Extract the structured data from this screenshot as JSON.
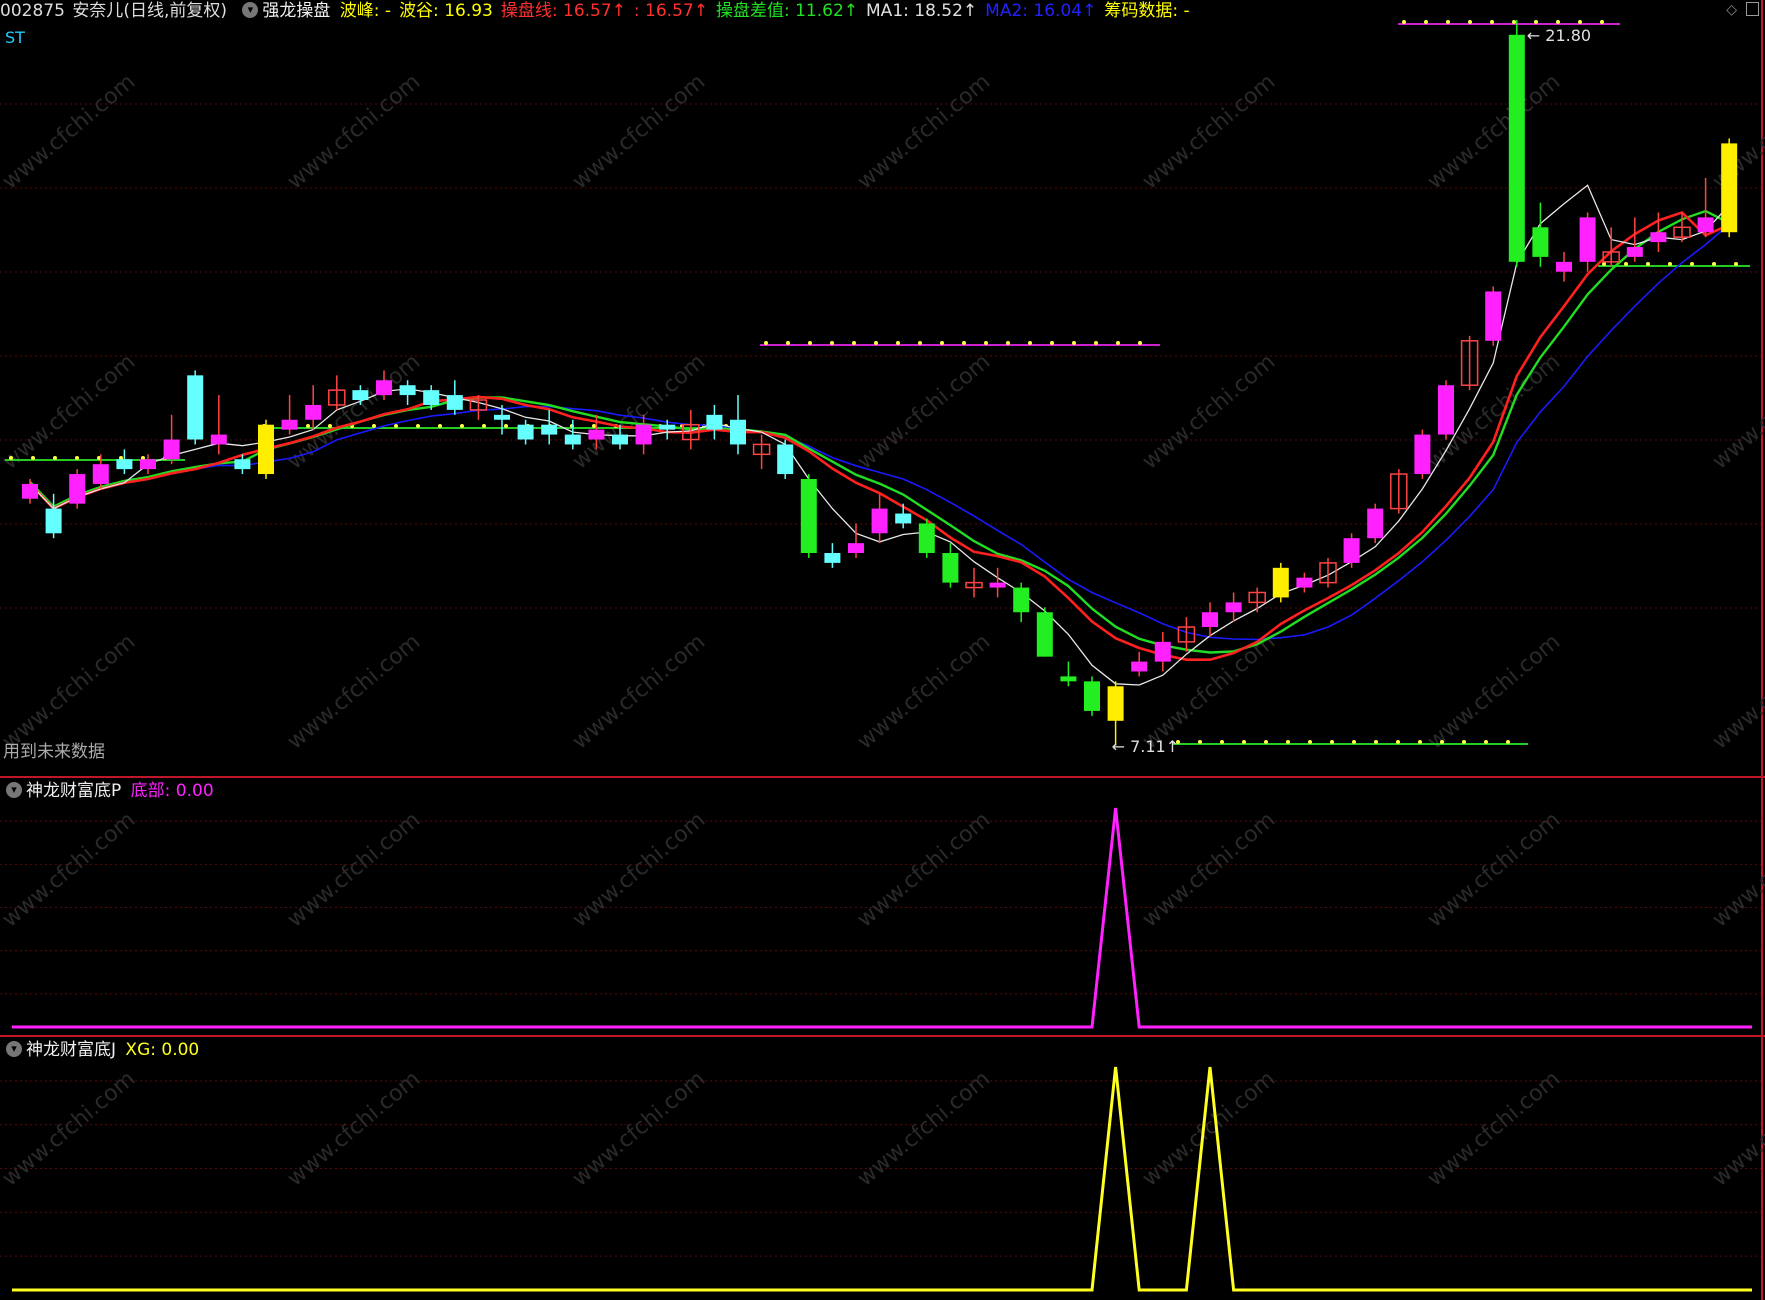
{
  "main_panel": {
    "header": {
      "code": "002875",
      "name": "安奈儿",
      "period": "(日线,前复权)",
      "indicator": "强龙操盘",
      "items": [
        {
          "label": "波峰:",
          "value": " -",
          "color": "#ffff00"
        },
        {
          "label": "波谷:",
          "value": " 16.93",
          "color": "#ffff00"
        },
        {
          "label": "操盘线:",
          "value": " 16.57",
          "color": "#ff3030",
          "arrow": "↑"
        },
        {
          "label": "",
          "value": ": 16.57",
          "color": "#ff3030",
          "arrow": "↑"
        },
        {
          "label": "操盘差值:",
          "value": " 11.62",
          "color": "#22e022",
          "arrow": "↑"
        },
        {
          "label": "MA1:",
          "value": " 18.52",
          "color": "#e0e0e0",
          "arrow": "↑"
        },
        {
          "label": "MA2:",
          "value": " 16.04",
          "color": "#2222ff",
          "arrow": "↑"
        },
        {
          "label": "筹码数据:",
          "value": " -",
          "color": "#ffff00"
        }
      ]
    },
    "st_label": "ST",
    "future_data_label": "用到未来数据",
    "high_label": "21.80",
    "low_label": "7.11"
  },
  "sub_panel_1": {
    "name": "神龙财富底P",
    "series_label": "底部:",
    "series_value": " 0.00",
    "color": "#ff22ff"
  },
  "sub_panel_2": {
    "name": "神龙财富底J",
    "series_label": "XG:",
    "series_value": " 0.00",
    "color": "#ffff22"
  },
  "watermark": "www.cfchi.com",
  "colors": {
    "up_candle": "#ff22ff",
    "down_candle": "#66ffff",
    "strong_down": "#22ee22",
    "signal": "#ffee00",
    "ma_white": "#e8e8e8",
    "ma_red": "#ff2020",
    "ma_blue": "#1a1aff",
    "ma_green": "#22dd22",
    "grid": "#5a0a0a"
  },
  "chart_data": [
    {
      "type": "candlestick",
      "title": "强龙操盘",
      "high": 21.8,
      "low": 7.11,
      "candles": [
        {
          "o": 12.1,
          "c": 12.4,
          "h": 12.5,
          "l": 12.0,
          "k": "up"
        },
        {
          "o": 11.9,
          "c": 11.4,
          "h": 12.2,
          "l": 11.3,
          "k": "dn"
        },
        {
          "o": 12.0,
          "c": 12.6,
          "h": 12.7,
          "l": 11.9,
          "k": "up"
        },
        {
          "o": 12.4,
          "c": 12.8,
          "h": 13.0,
          "l": 12.3,
          "k": "up"
        },
        {
          "o": 12.7,
          "c": 12.9,
          "h": 13.1,
          "l": 12.6,
          "k": "dn"
        },
        {
          "o": 12.7,
          "c": 12.9,
          "h": 13.0,
          "l": 12.6,
          "k": "up"
        },
        {
          "o": 12.9,
          "c": 13.3,
          "h": 13.8,
          "l": 12.8,
          "k": "up"
        },
        {
          "o": 14.6,
          "c": 13.3,
          "h": 14.7,
          "l": 13.2,
          "k": "dn"
        },
        {
          "o": 13.2,
          "c": 13.4,
          "h": 14.2,
          "l": 13.0,
          "k": "up"
        },
        {
          "o": 12.9,
          "c": 12.7,
          "h": 13.0,
          "l": 12.6,
          "k": "dn"
        },
        {
          "o": 12.6,
          "c": 13.6,
          "h": 13.7,
          "l": 12.5,
          "k": "sig"
        },
        {
          "o": 13.5,
          "c": 13.7,
          "h": 14.2,
          "l": 13.4,
          "k": "up"
        },
        {
          "o": 13.7,
          "c": 14.0,
          "h": 14.4,
          "l": 13.5,
          "k": "up"
        },
        {
          "o": 14.0,
          "c": 14.3,
          "h": 14.6,
          "l": 13.9,
          "k": "up"
        },
        {
          "o": 14.1,
          "c": 14.3,
          "h": 14.4,
          "l": 14.0,
          "k": "dn"
        },
        {
          "o": 14.2,
          "c": 14.5,
          "h": 14.7,
          "l": 14.1,
          "k": "up"
        },
        {
          "o": 14.4,
          "c": 14.2,
          "h": 14.5,
          "l": 14.0,
          "k": "dn"
        },
        {
          "o": 14.3,
          "c": 14.0,
          "h": 14.4,
          "l": 13.9,
          "k": "dn"
        },
        {
          "o": 14.2,
          "c": 13.9,
          "h": 14.5,
          "l": 13.8,
          "k": "dn"
        },
        {
          "o": 13.9,
          "c": 14.1,
          "h": 14.2,
          "l": 13.7,
          "k": "up"
        },
        {
          "o": 13.8,
          "c": 13.7,
          "h": 14.0,
          "l": 13.4,
          "k": "dn"
        },
        {
          "o": 13.6,
          "c": 13.3,
          "h": 13.7,
          "l": 13.2,
          "k": "dn"
        },
        {
          "o": 13.4,
          "c": 13.6,
          "h": 13.9,
          "l": 13.2,
          "k": "dn"
        },
        {
          "o": 13.4,
          "c": 13.2,
          "h": 13.7,
          "l": 13.1,
          "k": "dn"
        },
        {
          "o": 13.3,
          "c": 13.5,
          "h": 13.8,
          "l": 13.1,
          "k": "up"
        },
        {
          "o": 13.4,
          "c": 13.2,
          "h": 13.6,
          "l": 13.1,
          "k": "dn"
        },
        {
          "o": 13.2,
          "c": 13.6,
          "h": 13.8,
          "l": 13.0,
          "k": "up"
        },
        {
          "o": 13.6,
          "c": 13.5,
          "h": 13.7,
          "l": 13.3,
          "k": "dn"
        },
        {
          "o": 13.3,
          "c": 13.6,
          "h": 13.9,
          "l": 13.1,
          "k": "up"
        },
        {
          "o": 13.5,
          "c": 13.8,
          "h": 14.0,
          "l": 13.3,
          "k": "dn"
        },
        {
          "o": 13.7,
          "c": 13.2,
          "h": 14.2,
          "l": 13.0,
          "k": "dn"
        },
        {
          "o": 13.0,
          "c": 13.2,
          "h": 13.4,
          "l": 12.7,
          "k": "up"
        },
        {
          "o": 13.2,
          "c": 12.6,
          "h": 13.3,
          "l": 12.5,
          "k": "dn"
        },
        {
          "o": 12.5,
          "c": 11.0,
          "h": 12.6,
          "l": 10.9,
          "k": "grn"
        },
        {
          "o": 11.0,
          "c": 10.8,
          "h": 11.2,
          "l": 10.7,
          "k": "dn"
        },
        {
          "o": 11.0,
          "c": 11.2,
          "h": 11.6,
          "l": 10.9,
          "k": "up"
        },
        {
          "o": 11.4,
          "c": 11.9,
          "h": 12.2,
          "l": 11.2,
          "k": "up"
        },
        {
          "o": 11.8,
          "c": 11.6,
          "h": 12.0,
          "l": 11.5,
          "k": "dn"
        },
        {
          "o": 11.6,
          "c": 11.0,
          "h": 11.7,
          "l": 10.9,
          "k": "grn"
        },
        {
          "o": 11.0,
          "c": 10.4,
          "h": 11.2,
          "l": 10.3,
          "k": "grn"
        },
        {
          "o": 10.4,
          "c": 10.3,
          "h": 10.7,
          "l": 10.1,
          "k": "up"
        },
        {
          "o": 10.4,
          "c": 10.3,
          "h": 10.7,
          "l": 10.1,
          "k": "up"
        },
        {
          "o": 10.3,
          "c": 9.8,
          "h": 10.4,
          "l": 9.6,
          "k": "grn"
        },
        {
          "o": 9.8,
          "c": 8.9,
          "h": 9.9,
          "l": 8.9,
          "k": "grn"
        },
        {
          "o": 8.5,
          "c": 8.4,
          "h": 8.8,
          "l": 8.3,
          "k": "grn"
        },
        {
          "o": 8.4,
          "c": 7.8,
          "h": 8.5,
          "l": 7.7,
          "k": "grn"
        },
        {
          "o": 7.6,
          "c": 8.3,
          "h": 8.4,
          "l": 7.1,
          "k": "sig"
        },
        {
          "o": 8.6,
          "c": 8.8,
          "h": 9.0,
          "l": 8.5,
          "k": "up"
        },
        {
          "o": 8.8,
          "c": 9.2,
          "h": 9.4,
          "l": 8.6,
          "k": "up"
        },
        {
          "o": 9.2,
          "c": 9.5,
          "h": 9.7,
          "l": 9.0,
          "k": "up"
        },
        {
          "o": 9.5,
          "c": 9.8,
          "h": 10.0,
          "l": 9.3,
          "k": "up"
        },
        {
          "o": 9.8,
          "c": 10.0,
          "h": 10.2,
          "l": 9.6,
          "k": "up"
        },
        {
          "o": 10.0,
          "c": 10.2,
          "h": 10.3,
          "l": 9.8,
          "k": "up"
        },
        {
          "o": 10.1,
          "c": 10.7,
          "h": 10.8,
          "l": 10.0,
          "k": "sig"
        },
        {
          "o": 10.3,
          "c": 10.5,
          "h": 10.6,
          "l": 10.2,
          "k": "up"
        },
        {
          "o": 10.4,
          "c": 10.8,
          "h": 10.9,
          "l": 10.3,
          "k": "up"
        },
        {
          "o": 10.8,
          "c": 11.3,
          "h": 11.4,
          "l": 10.7,
          "k": "up"
        },
        {
          "o": 11.3,
          "c": 11.9,
          "h": 12.0,
          "l": 11.2,
          "k": "up"
        },
        {
          "o": 11.9,
          "c": 12.6,
          "h": 12.7,
          "l": 11.8,
          "k": "up"
        },
        {
          "o": 12.6,
          "c": 13.4,
          "h": 13.5,
          "l": 12.5,
          "k": "up"
        },
        {
          "o": 13.4,
          "c": 14.4,
          "h": 14.5,
          "l": 13.3,
          "k": "up"
        },
        {
          "o": 14.4,
          "c": 15.3,
          "h": 15.4,
          "l": 14.3,
          "k": "up"
        },
        {
          "o": 15.3,
          "c": 16.3,
          "h": 16.4,
          "l": 15.2,
          "k": "up"
        },
        {
          "o": 16.9,
          "c": 21.5,
          "h": 21.8,
          "l": 16.8,
          "k": "grn"
        },
        {
          "o": 17.0,
          "c": 17.6,
          "h": 18.1,
          "l": 16.8,
          "k": "grn"
        },
        {
          "o": 16.7,
          "c": 16.9,
          "h": 17.1,
          "l": 16.5,
          "k": "up"
        },
        {
          "o": 16.9,
          "c": 17.8,
          "h": 17.9,
          "l": 16.7,
          "k": "up"
        },
        {
          "o": 16.9,
          "c": 17.1,
          "h": 17.6,
          "l": 16.8,
          "k": "up"
        },
        {
          "o": 17.0,
          "c": 17.2,
          "h": 17.8,
          "l": 16.9,
          "k": "up"
        },
        {
          "o": 17.3,
          "c": 17.5,
          "h": 17.9,
          "l": 17.1,
          "k": "up"
        },
        {
          "o": 17.4,
          "c": 17.6,
          "h": 17.9,
          "l": 17.3,
          "k": "up"
        },
        {
          "o": 17.5,
          "c": 17.8,
          "h": 18.6,
          "l": 17.4,
          "k": "up"
        },
        {
          "o": 17.5,
          "c": 19.3,
          "h": 19.4,
          "l": 17.4,
          "k": "sig"
        }
      ]
    },
    {
      "type": "line",
      "title": "神龙财富底P",
      "x": [
        0,
        45,
        46,
        47,
        73
      ],
      "y": [
        0,
        0,
        1,
        0,
        0
      ]
    },
    {
      "type": "line",
      "title": "神龙财富底J",
      "x": [
        0,
        45,
        46,
        47,
        49,
        50,
        51,
        73
      ],
      "y": [
        0,
        0,
        1,
        0,
        0,
        1,
        0,
        0
      ]
    }
  ]
}
